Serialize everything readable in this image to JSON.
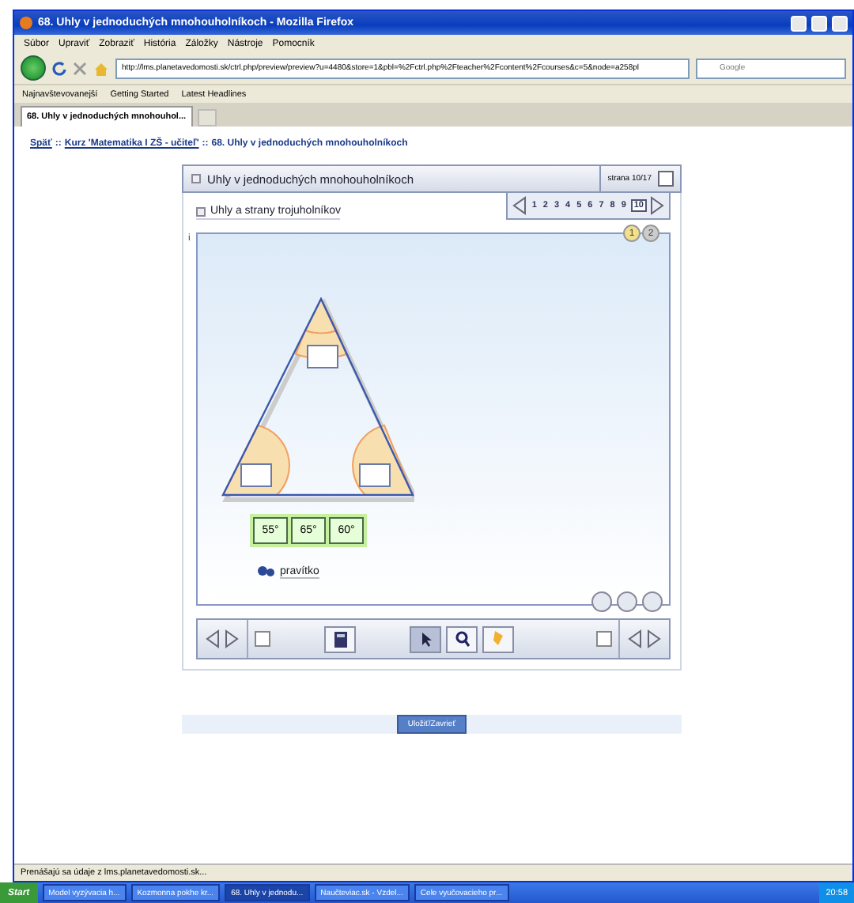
{
  "window": {
    "title": "68. Uhly v jednoduchých mnohouholníkoch - Mozilla Firefox"
  },
  "menu": [
    "Súbor",
    "Upraviť",
    "Zobraziť",
    "História",
    "Záložky",
    "Nástroje",
    "Pomocník"
  ],
  "address": {
    "value": "http://lms.planetavedomosti.sk/ctrl.php/preview/preview?u=4480&store=1&pbl=%2Fctrl.php%2Fteacher%2Fcontent%2Fcourses&c=5&node=a258pl"
  },
  "search": {
    "placeholder": "Google"
  },
  "bookmarks": [
    "Najnavštevovanejší",
    "Getting Started",
    "Latest Headlines"
  ],
  "tabs": [
    {
      "label": "68. Uhly v jednoduchých mnohouhol...",
      "selected": true
    }
  ],
  "breadcrumb": {
    "links": [
      "Späť",
      "Kurz 'Matematika I ZŠ - učiteľ'"
    ],
    "separator": "::",
    "current": "68. Uhly v jednoduchých mnohouholníkoch"
  },
  "panel": {
    "title": "Uhly v jednoduchých mnohouholníkoch",
    "page_label": "strana 10/17",
    "pages": [
      {
        "label": "1",
        "selected": false
      },
      {
        "label": "2",
        "selected": false
      },
      {
        "label": "3",
        "selected": false
      },
      {
        "label": "4",
        "selected": false
      },
      {
        "label": "5",
        "selected": false
      },
      {
        "label": "6",
        "selected": false
      },
      {
        "label": "7",
        "selected": false
      },
      {
        "label": "8",
        "selected": false
      },
      {
        "label": "9",
        "selected": false
      },
      {
        "label": "10",
        "selected": true
      }
    ],
    "subtitle": "Uhly a strany trojuholníkov",
    "info": "i",
    "steps": [
      {
        "label": "1",
        "selected": true
      },
      {
        "label": "2",
        "selected": false
      }
    ],
    "answers": [
      "55°",
      "65°",
      "60°"
    ],
    "tool_label": "pravítko",
    "tools": [
      {
        "kind": "calculator",
        "selected": false
      },
      {
        "kind": "pointer",
        "selected": true
      },
      {
        "kind": "magnifier",
        "selected": false
      },
      {
        "kind": "marker",
        "selected": false
      }
    ],
    "save_button": "Uložiť/Zavrieť"
  },
  "status_bar": "Prenášajú sa údaje z lms.planetavedomosti.sk...",
  "taskbar": {
    "start": "Start",
    "items": [
      {
        "label": "Model vyzývacia h...",
        "selected": false
      },
      {
        "label": "Kozmonna pokhe kr...",
        "selected": false
      },
      {
        "label": "68. Uhly v jednodu...",
        "selected": true
      },
      {
        "label": "Naučteviac.sk - Vzdel...",
        "selected": false
      },
      {
        "label": "Cele vyučovacieho pr...",
        "selected": false
      }
    ],
    "clock": "20:58"
  }
}
